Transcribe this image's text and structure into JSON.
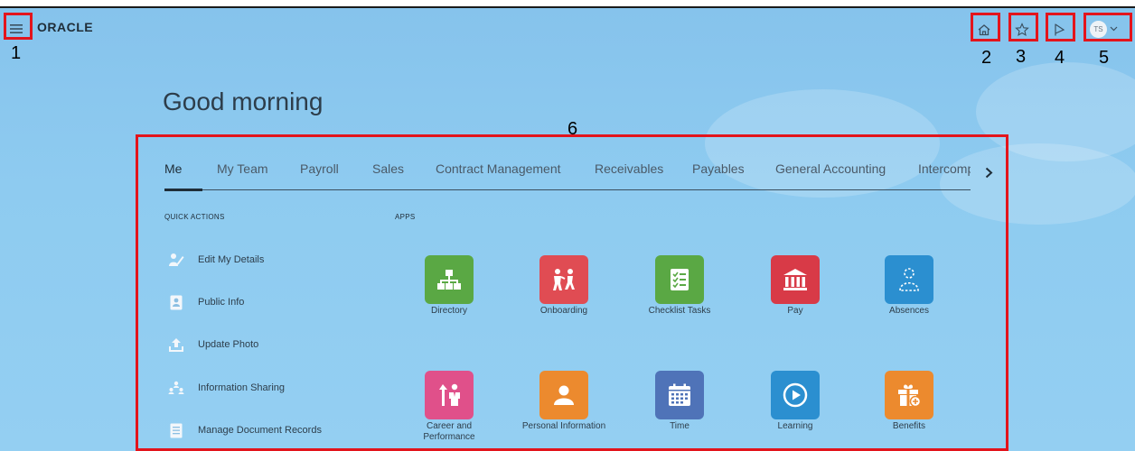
{
  "header": {
    "logo": "ORACLE",
    "icons": [
      "menu-icon",
      "home-icon",
      "favorites-star-icon",
      "notifications-flag-icon"
    ],
    "user_initials": "TS"
  },
  "annotations": [
    "1",
    "2",
    "3",
    "4",
    "5",
    "6"
  ],
  "greeting": "Good morning",
  "tabs": [
    "Me",
    "My Team",
    "Payroll",
    "Sales",
    "Contract Management",
    "Receivables",
    "Payables",
    "General Accounting",
    "Intercomp"
  ],
  "quick_actions": {
    "title": "QUICK ACTIONS",
    "items": [
      {
        "label": "Edit My Details",
        "icon": "edit-person-icon"
      },
      {
        "label": "Public Info",
        "icon": "id-badge-icon"
      },
      {
        "label": "Update Photo",
        "icon": "upload-icon"
      },
      {
        "label": "Information Sharing",
        "icon": "share-people-icon"
      },
      {
        "label": "Manage Document Records",
        "icon": "document-icon"
      }
    ]
  },
  "apps": {
    "title": "APPS",
    "items": [
      {
        "label": "Directory",
        "color": "#5aa844",
        "icon": "org-chart-icon"
      },
      {
        "label": "Onboarding",
        "color": "#e04c53",
        "icon": "onboarding-people-icon"
      },
      {
        "label": "Checklist Tasks",
        "color": "#5aa844",
        "icon": "checklist-icon"
      },
      {
        "label": "Pay",
        "color": "#d83a47",
        "icon": "bank-icon"
      },
      {
        "label": "Absences",
        "color": "#2b8fd0",
        "icon": "absence-person-icon"
      },
      {
        "label": "Career and Performance",
        "color": "#e0508a",
        "icon": "career-people-icon"
      },
      {
        "label": "Personal Information",
        "color": "#ec8a2e",
        "icon": "person-card-icon"
      },
      {
        "label": "Time",
        "color": "#4f73b8",
        "icon": "calendar-icon"
      },
      {
        "label": "Learning",
        "color": "#2b8fd0",
        "icon": "play-circle-icon"
      },
      {
        "label": "Benefits",
        "color": "#ec8a2e",
        "icon": "gift-icon"
      }
    ]
  }
}
